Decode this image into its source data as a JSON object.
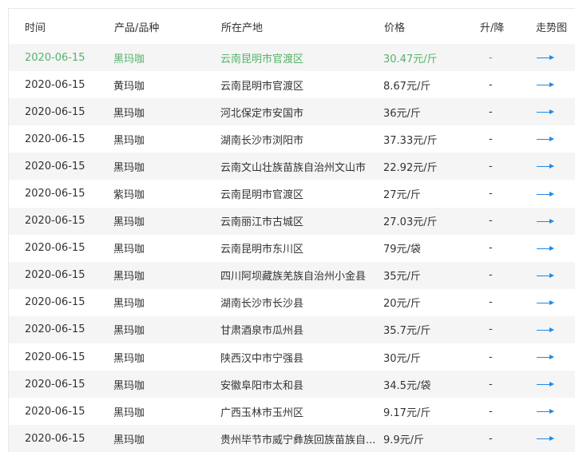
{
  "table": {
    "headers": [
      "时间",
      "产品/品种",
      "所在产地",
      "价格",
      "升/降",
      "走势图"
    ],
    "rows": [
      {
        "date": "2020-06-15",
        "product": "黑玛咖",
        "origin": "云南昆明市官渡区",
        "price": "30.47元/斤",
        "change": "-",
        "highlight": true
      },
      {
        "date": "2020-06-15",
        "product": "黄玛咖",
        "origin": "云南昆明市官渡区",
        "price": "8.67元/斤",
        "change": "-"
      },
      {
        "date": "2020-06-15",
        "product": "黑玛咖",
        "origin": "河北保定市安国市",
        "price": "36元/斤",
        "change": "-"
      },
      {
        "date": "2020-06-15",
        "product": "黑玛咖",
        "origin": "湖南长沙市浏阳市",
        "price": "37.33元/斤",
        "change": "-"
      },
      {
        "date": "2020-06-15",
        "product": "黑玛咖",
        "origin": "云南文山壮族苗族自治州文山市",
        "price": "22.92元/斤",
        "change": "-"
      },
      {
        "date": "2020-06-15",
        "product": "紫玛咖",
        "origin": "云南昆明市官渡区",
        "price": "27元/斤",
        "change": "-"
      },
      {
        "date": "2020-06-15",
        "product": "黑玛咖",
        "origin": "云南丽江市古城区",
        "price": "27.03元/斤",
        "change": "-"
      },
      {
        "date": "2020-06-15",
        "product": "黑玛咖",
        "origin": "云南昆明市东川区",
        "price": "79元/袋",
        "change": "-"
      },
      {
        "date": "2020-06-15",
        "product": "黑玛咖",
        "origin": "四川阿坝藏族羌族自治州小金县",
        "price": "35元/斤",
        "change": "-"
      },
      {
        "date": "2020-06-15",
        "product": "黑玛咖",
        "origin": "湖南长沙市长沙县",
        "price": "20元/斤",
        "change": "-"
      },
      {
        "date": "2020-06-15",
        "product": "黑玛咖",
        "origin": "甘肃酒泉市瓜州县",
        "price": "35.7元/斤",
        "change": "-"
      },
      {
        "date": "2020-06-15",
        "product": "黑玛咖",
        "origin": "陕西汉中市宁强县",
        "price": "30元/斤",
        "change": "-"
      },
      {
        "date": "2020-06-15",
        "product": "黑玛咖",
        "origin": "安徽阜阳市太和县",
        "price": "34.5元/袋",
        "change": "-"
      },
      {
        "date": "2020-06-15",
        "product": "黑玛咖",
        "origin": "广西玉林市玉州区",
        "price": "9.17元/斤",
        "change": "-"
      },
      {
        "date": "2020-06-15",
        "product": "黑玛咖",
        "origin": "贵州毕节市威宁彝族回族苗族自...",
        "price": "9.9元/斤",
        "change": "-"
      }
    ]
  },
  "colors": {
    "highlight_text": "#56b26a",
    "arrow": "#1e8ae6",
    "row_alt": "#f5f5f5"
  },
  "icons": {
    "trend": "arrow-right-icon"
  }
}
